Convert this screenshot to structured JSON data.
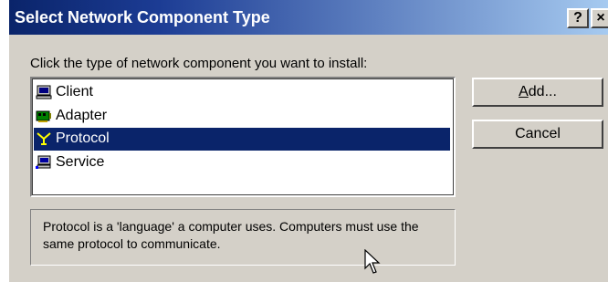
{
  "window": {
    "title": "Select Network Component Type",
    "help_label": "?",
    "close_label": "×"
  },
  "instruction": "Click the type of network component you want to install:",
  "component_list": {
    "items": [
      {
        "label": "Client",
        "icon": "client-computer-icon",
        "selected": false
      },
      {
        "label": "Adapter",
        "icon": "network-adapter-icon",
        "selected": false
      },
      {
        "label": "Protocol",
        "icon": "protocol-icon",
        "selected": true
      },
      {
        "label": "Service",
        "icon": "service-icon",
        "selected": false
      }
    ]
  },
  "buttons": {
    "add_prefix": "",
    "add_mnemonic": "A",
    "add_rest": "dd...",
    "cancel_label": "Cancel"
  },
  "description": "Protocol is a 'language' a computer uses. Computers must use the same protocol to communicate.",
  "colors": {
    "selection": "#0a246a",
    "dialog_face": "#d4d0c8",
    "titlebar_start": "#0a246a",
    "titlebar_end": "#a6caf0"
  }
}
